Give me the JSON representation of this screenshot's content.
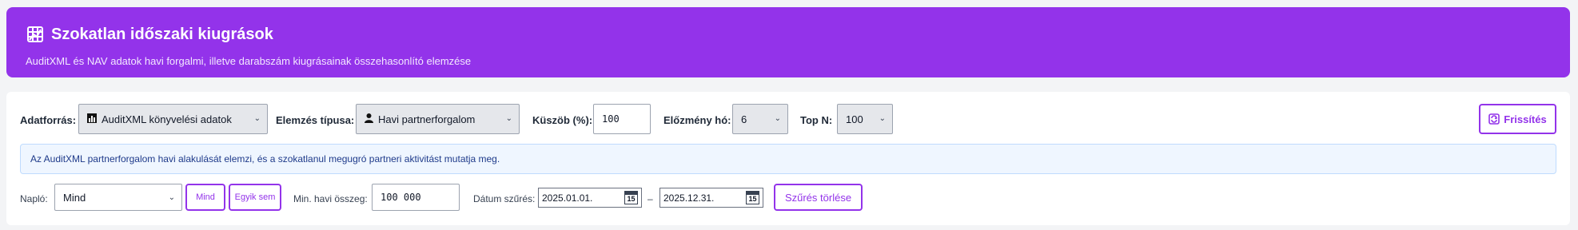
{
  "header": {
    "title": "Szokatlan időszaki kiugrások",
    "subtitle": "AuditXML és NAV adatok havi forgalmi, illetve darabszám kiugrásainak összehasonlító elemzése",
    "icon": "chart-grid-icon"
  },
  "controls": {
    "source_label": "Adatforrás:",
    "source_value": "AuditXML könyvelési adatok",
    "analysis_label": "Elemzés típusa:",
    "analysis_value": "Havi partnerforgalom",
    "threshold_label": "Küszöb (%):",
    "threshold_value": "100",
    "history_label": "Előzmény hó:",
    "history_value": "6",
    "topn_label": "Top N:",
    "topn_value": "100",
    "refresh_label": "Frissítés"
  },
  "info": {
    "text": "Az AuditXML partnerforgalom havi alakulását elemzi, és a szokatlanul megugró partneri aktivitást mutatja meg."
  },
  "filters": {
    "journal_label": "Napló:",
    "journal_value": "Mind",
    "all_label": "Mind",
    "none_label": "Egyik sem",
    "min_sum_label": "Min. havi összeg:",
    "min_sum_value": "100 000",
    "date_label": "Dátum szűrés:",
    "date_from": "2025.01.01.",
    "date_sep": "–",
    "date_to": "2025.12.31.",
    "clear_label": "Szűrés törlése"
  },
  "colors": {
    "accent": "#9333ea",
    "info_bg": "#eff6ff"
  }
}
